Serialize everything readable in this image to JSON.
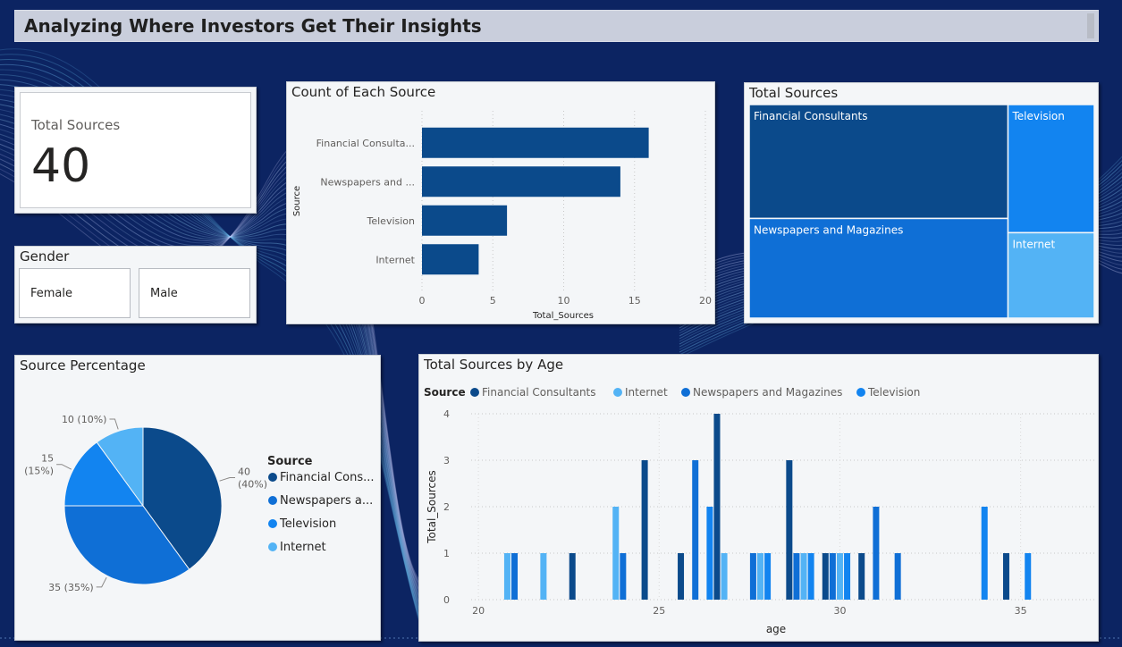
{
  "header": {
    "title": "Analyzing Where Investors Get Their Insights"
  },
  "card": {
    "label": "Total Sources",
    "value": "40"
  },
  "gender_slicer": {
    "title": "Gender",
    "options": [
      "Female",
      "Male"
    ]
  },
  "colors": {
    "Financial Consultants": "#0b4a8b",
    "Newspapers and Magazines": "#0f6fd6",
    "Television": "#1284f0",
    "Internet": "#53b3f5",
    "background": "#0c2462",
    "panel": "#f4f6f8"
  },
  "bar_chart": {
    "title": "Count of Each Source",
    "chart_data": {
      "type": "bar",
      "orientation": "horizontal",
      "categories": [
        "Financial Consulta...",
        "Newspapers and ...",
        "Television",
        "Internet"
      ],
      "values": [
        16,
        14,
        6,
        4
      ],
      "xlabel": "Total_Sources",
      "ylabel": "Source",
      "xlim": [
        0,
        20
      ],
      "xticks": [
        0,
        5,
        10,
        15,
        20
      ],
      "grid": true
    }
  },
  "treemap": {
    "title": "Total Sources",
    "chart_data": {
      "type": "treemap",
      "items": [
        {
          "label": "Financial Consultants",
          "value": 16
        },
        {
          "label": "Newspapers and Magazines",
          "value": 14
        },
        {
          "label": "Television",
          "value": 6
        },
        {
          "label": "Internet",
          "value": 4
        }
      ]
    }
  },
  "pie_chart": {
    "title": "Source Percentage",
    "legend_title": "Source",
    "legend_items": [
      "Financial Cons...",
      "Newspapers a...",
      "Television",
      "Internet"
    ],
    "chart_data": {
      "type": "pie",
      "labels": [
        "Financial Consultants",
        "Newspapers and Magazines",
        "Television",
        "Internet"
      ],
      "values": [
        40,
        35,
        15,
        10
      ],
      "data_labels": [
        [
          "40",
          "(40%)"
        ],
        [
          "35 (35%)"
        ],
        [
          "15",
          "(15%)"
        ],
        [
          "10 (10%)"
        ]
      ],
      "legend": "right"
    }
  },
  "column_chart": {
    "title": "Total Sources by Age",
    "legend_title": "Source",
    "legend_items": [
      "Financial Consultants",
      "Internet",
      "Newspapers and Magazines",
      "Television"
    ],
    "chart_data": {
      "type": "bar",
      "xlabel": "age",
      "ylabel": "Total_Sources",
      "xlim": [
        19.8,
        35.8
      ],
      "ylim": [
        0,
        4
      ],
      "xticks": [
        20,
        25,
        30,
        35
      ],
      "yticks": [
        0,
        1,
        2,
        3,
        4
      ],
      "grid": true,
      "series": [
        {
          "name": "Financial Consultants",
          "points": [
            [
              22.6,
              1
            ],
            [
              24.6,
              3
            ],
            [
              25.6,
              1
            ],
            [
              26.6,
              4
            ],
            [
              28.6,
              3
            ],
            [
              29.6,
              1
            ],
            [
              30.6,
              1
            ],
            [
              34.6,
              1
            ]
          ]
        },
        {
          "name": "Internet",
          "points": [
            [
              20.8,
              1
            ],
            [
              21.8,
              1
            ],
            [
              23.8,
              2
            ],
            [
              26.8,
              1
            ],
            [
              27.8,
              1
            ],
            [
              29.0,
              1
            ],
            [
              30.0,
              1
            ]
          ]
        },
        {
          "name": "Newspapers and Magazines",
          "points": [
            [
              21.0,
              1
            ],
            [
              24.0,
              1
            ],
            [
              26.0,
              3
            ],
            [
              27.6,
              1
            ],
            [
              28.8,
              1
            ],
            [
              29.8,
              1
            ],
            [
              31.0,
              2
            ],
            [
              31.6,
              1
            ]
          ]
        },
        {
          "name": "Television",
          "points": [
            [
              26.4,
              2
            ],
            [
              28.0,
              1
            ],
            [
              29.2,
              1
            ],
            [
              30.2,
              1
            ],
            [
              34.0,
              2
            ],
            [
              35.2,
              1
            ]
          ]
        }
      ]
    }
  }
}
